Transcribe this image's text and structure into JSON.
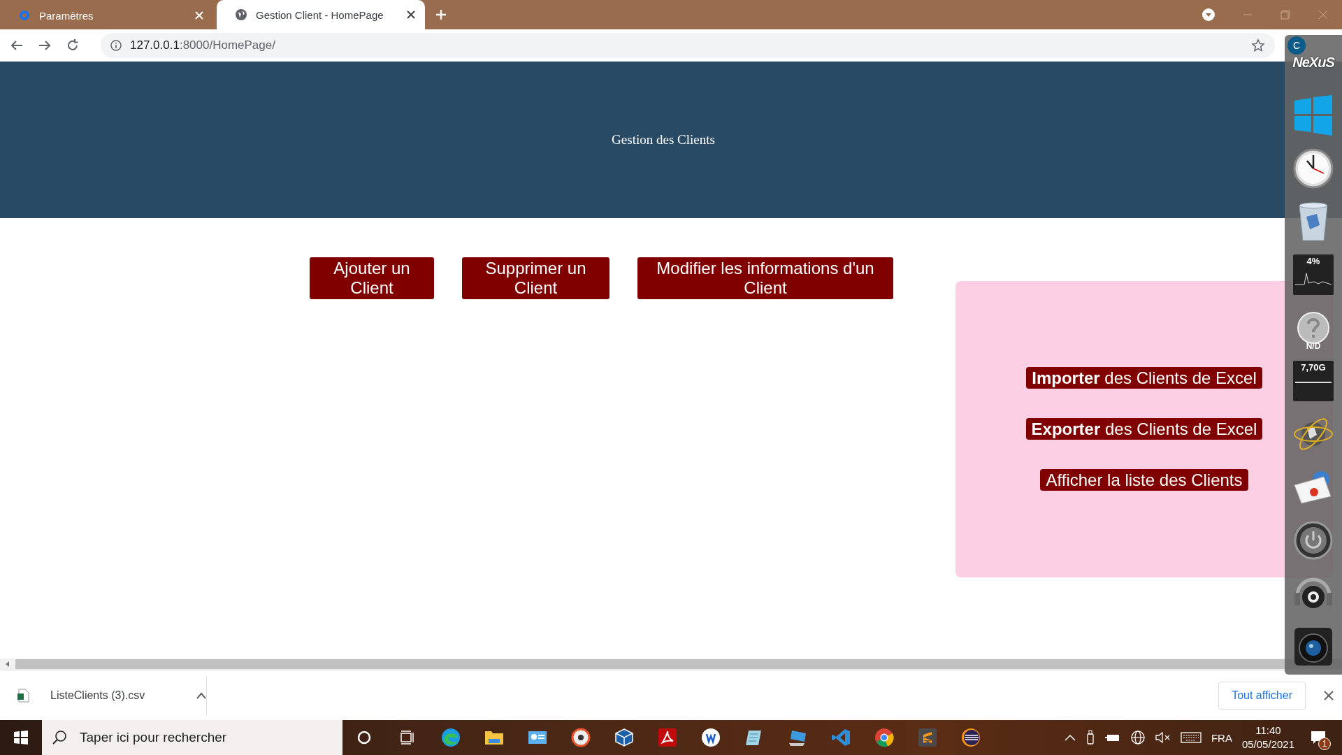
{
  "browser": {
    "tabs": [
      {
        "title": "Paramètres",
        "selected": false,
        "kind": "settings"
      },
      {
        "title": "Gestion Client - HomePage",
        "selected": true,
        "kind": "web"
      }
    ],
    "address": {
      "host": "127.0.0.1",
      "rest": ":8000/HomePage/"
    },
    "profile": "C"
  },
  "header": {
    "title": "Gestion des Clients"
  },
  "actions": [
    "Ajouter un Client",
    "Supprimer un Client",
    "Modifier les informations d'un Client"
  ],
  "panel": {
    "links": [
      "**Importer** des Clients de Excel",
      "**Exporter** des Clients de Excel",
      "Afficher la liste des Clients"
    ]
  },
  "dock": {
    "logo": "NeXuS",
    "cpu": "4%",
    "unknown": "N/D",
    "memory": "7,70G"
  },
  "downloads": {
    "file": "ListeClients (3).csv",
    "show_all": "Tout afficher"
  },
  "taskbar": {
    "search_placeholder": "Taper ici pour rechercher",
    "language": "FRA",
    "time": "11:40",
    "date": "05/05/2021",
    "notifications": "1"
  }
}
